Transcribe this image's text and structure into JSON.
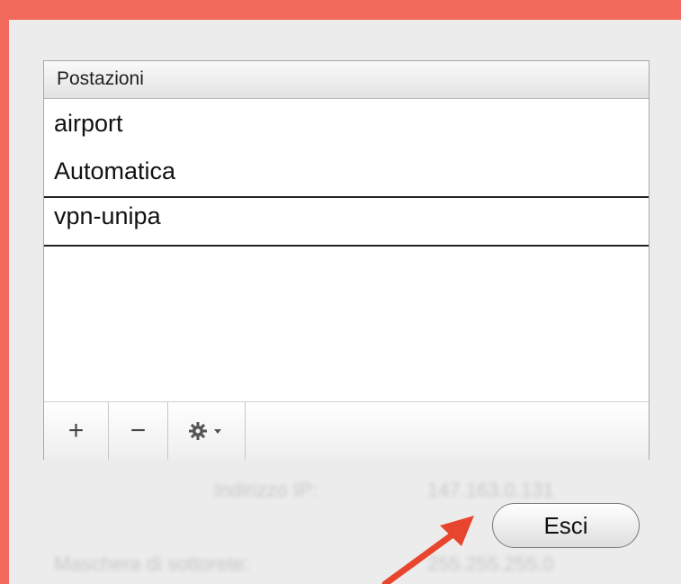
{
  "panel": {
    "header": "Postazioni",
    "items": [
      "airport",
      "Automatica",
      "vpn-unipa"
    ],
    "selected_item": "vpn-unipa"
  },
  "toolbar": {
    "add_label": "+",
    "remove_label": "−"
  },
  "dialog": {
    "quit_label": "Esci"
  },
  "background_labels": {
    "ip_label": "Indirizzo IP:",
    "ip_value": "147.163.0.131",
    "mask_label": "Maschera di sottorete:",
    "mask_value": "255.255.255.0"
  },
  "colors": {
    "frame": "#f26a5b",
    "annotation_arrow": "#e8452f"
  }
}
